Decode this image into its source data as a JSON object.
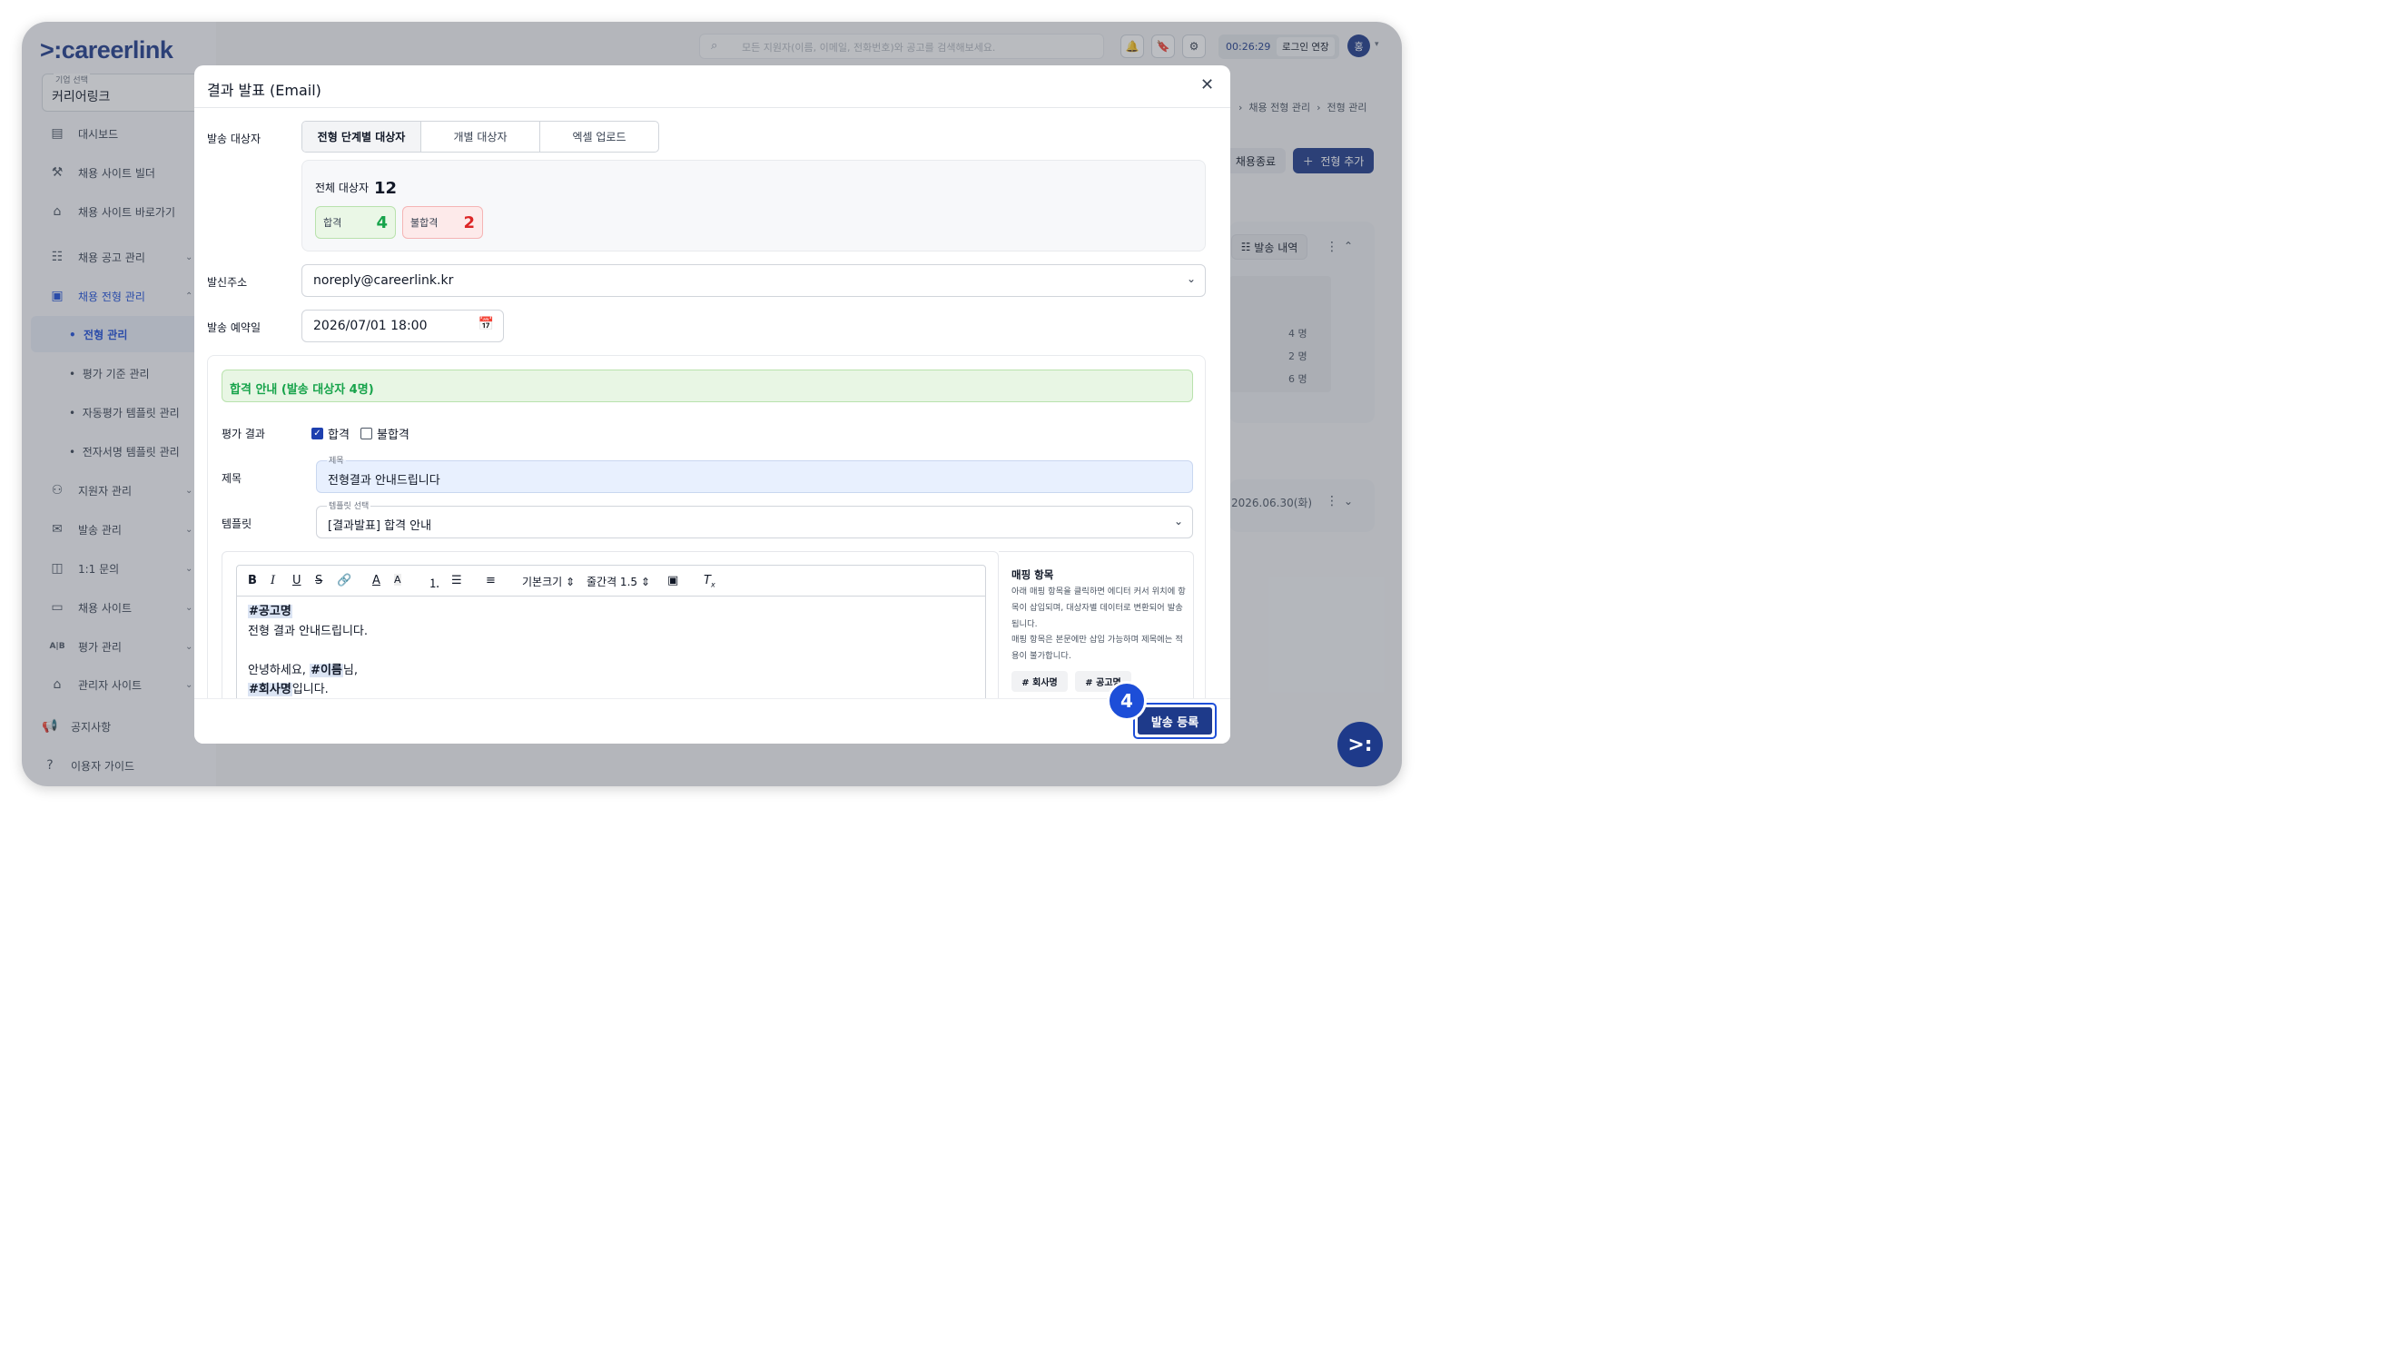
{
  "app": {
    "logo": "careerlink"
  },
  "sidebar": {
    "company_caption": "기업 선택",
    "company_value": "커리어링크",
    "items": [
      {
        "label": "대시보드",
        "icon": "chart-icon"
      },
      {
        "label": "채용 사이트 빌더",
        "icon": "wrench-icon"
      },
      {
        "label": "채용 사이트 바로가기",
        "icon": "home-icon"
      },
      {
        "label": "채용 공고 관리",
        "icon": "list-icon"
      },
      {
        "label": "채용 전형 관리",
        "icon": "clipboard-icon"
      },
      {
        "label": "지원자 관리",
        "icon": "users-icon"
      },
      {
        "label": "발송 관리",
        "icon": "mail-icon"
      },
      {
        "label": "1:1 문의",
        "icon": "chat-icon"
      },
      {
        "label": "채용 사이트",
        "icon": "browser-icon"
      },
      {
        "label": "평가 관리",
        "icon": "ab-icon"
      },
      {
        "label": "관리자 사이트",
        "icon": "home-gear-icon"
      },
      {
        "label": "공지사항",
        "icon": "megaphone-icon"
      },
      {
        "label": "이용자 가이드",
        "icon": "help-icon"
      }
    ],
    "sub_items": [
      "전형 관리",
      "평가 기준 관리",
      "자동평가 템플릿 관리",
      "전자서명 템플릿 관리"
    ]
  },
  "topbar": {
    "search_placeholder": "모든 지원자(이름, 이메일, 전화번호)와 공고를 검색해보세요.",
    "timer": "00:26:29",
    "extend_label": "로그인 연장",
    "avatar_initial": "홍"
  },
  "background": {
    "breadcrumb": [
      "채용 전형 관리",
      "전형 관리"
    ],
    "end_button": "채용종료",
    "add_button": "전형 추가",
    "history_button": "발송 내역",
    "counts": [
      "4 명",
      "2 명",
      "6 명"
    ],
    "date": "2026.06.30(화)"
  },
  "modal": {
    "title": "결과 발표 (Email)",
    "target_label": "발송 대상자",
    "tabs": [
      "전형 단계별 대상자",
      "개별 대상자",
      "엑셀 업로드"
    ],
    "total_label": "전체 대상자",
    "total_count": "12",
    "pass_label": "합격",
    "pass_count": "4",
    "fail_label": "불합격",
    "fail_count": "2",
    "sender_label": "발신주소",
    "sender_value": "noreply@careerlink.kr",
    "date_label": "발송 예약일",
    "date_value": "2026/07/01 18:00",
    "banner": "합격 안내 (발송 대상자 4명)",
    "eval_label": "평가 결과",
    "eval_pass": "합격",
    "eval_fail": "불합격",
    "eval_pass_checked": true,
    "eval_fail_checked": false,
    "subject_label": "제목",
    "subject_caption": "제목",
    "subject_value": "전형결과 안내드립니다",
    "template_label": "템플릿",
    "template_caption": "템플릿 선택",
    "template_value": "[결과발표] 합격 안내",
    "toolbar": {
      "font_size": "기본크기",
      "line_height": "줄간격 1.5"
    },
    "body": {
      "line1_tag": "#공고명",
      "line2": "전형 결과 안내드립니다.",
      "line4_pre": "안녕하세요, ",
      "line4_tag": "#이름",
      "line4_post": "님,",
      "line5_tag": "#회사명",
      "line5_post": "입니다."
    },
    "mapping": {
      "title": "매핑 항목",
      "desc": "아래 매핑 항목을 클릭하면 에디터 커서 위치에 항목이 삽입되며, 대상자별 데이터로 변환되어 발송됩니다.",
      "desc2": "매핑 항목은 본문에만 삽입 가능하며 제목에는 적용이 불가합니다.",
      "tags": [
        "# 회사명",
        "# 공고명"
      ]
    },
    "submit_label": "발송 등록",
    "step_number": "4"
  }
}
